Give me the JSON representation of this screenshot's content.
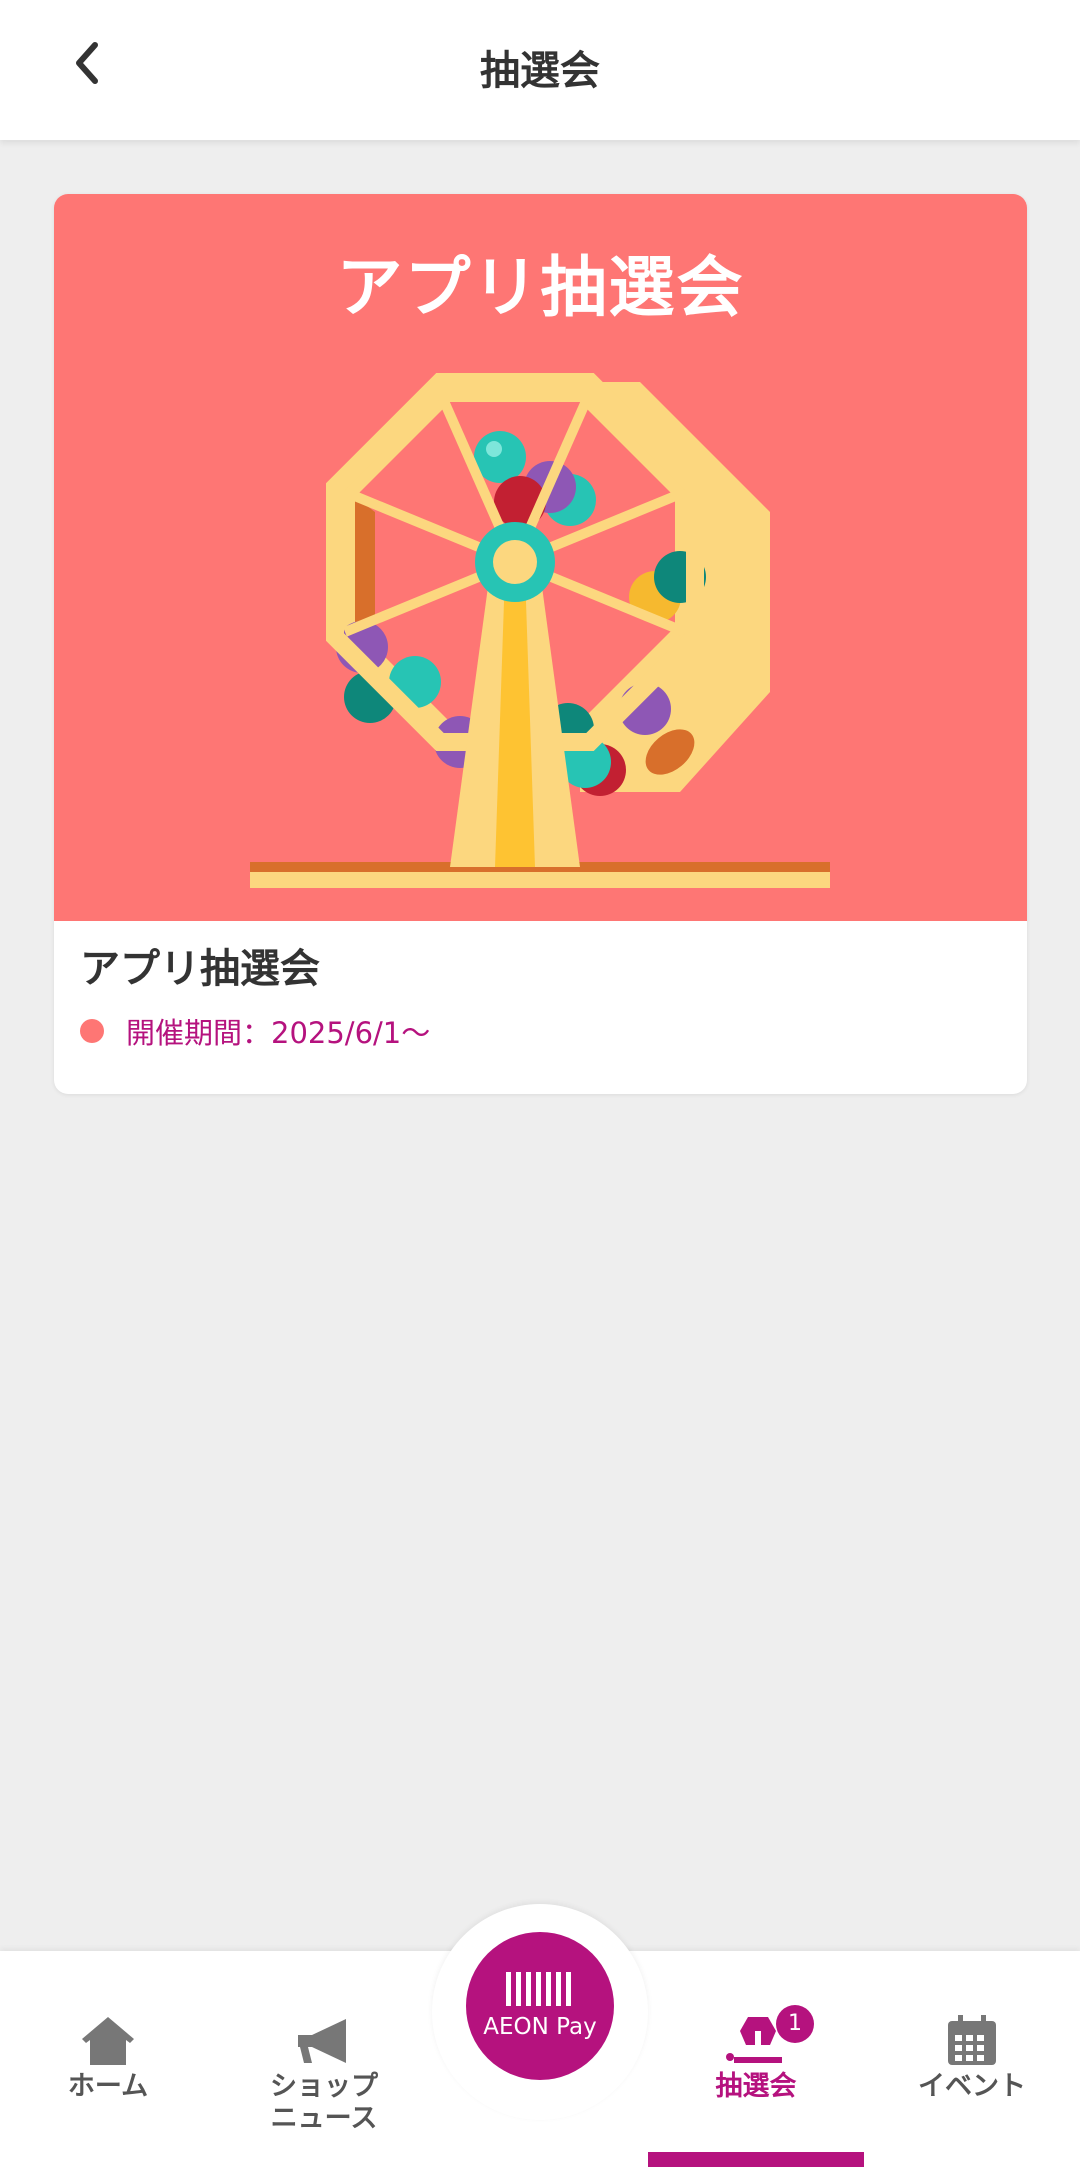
{
  "header": {
    "title": "抽選会",
    "back_icon": "chevron-left-icon"
  },
  "card": {
    "banner_title": "アプリ抽選会",
    "title": "アプリ抽選会",
    "period": "開催期間：2025/6/1〜"
  },
  "bottom_nav": {
    "items": [
      {
        "label": "ホーム",
        "icon": "home-icon"
      },
      {
        "label": "ショップ\nニュース",
        "icon": "megaphone-icon"
      },
      {
        "label": "AEON Pay",
        "icon": "barcode-icon"
      },
      {
        "label": "抽選会",
        "icon": "lottery-icon",
        "badge": "1",
        "active": true
      },
      {
        "label": "イベント",
        "icon": "calendar-icon"
      }
    ]
  },
  "colors": {
    "accent": "#b5127e",
    "banner": "#fe7674",
    "background": "#eeeeee"
  }
}
